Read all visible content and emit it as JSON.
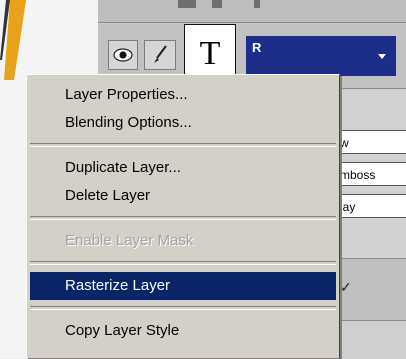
{
  "layers_panel": {
    "layer_thumbnail_glyph": "T",
    "layer_name": "R",
    "effects": [
      "w",
      "mboss",
      "lay"
    ],
    "check_glyph": "✓"
  },
  "context_menu": {
    "groups": [
      [
        {
          "label": "Layer Properties...",
          "state": "normal"
        },
        {
          "label": "Blending Options...",
          "state": "normal"
        }
      ],
      [
        {
          "label": "Duplicate Layer...",
          "state": "normal"
        },
        {
          "label": "Delete Layer",
          "state": "normal"
        }
      ],
      [
        {
          "label": "Enable Layer Mask",
          "state": "disabled"
        }
      ],
      [
        {
          "label": "Rasterize Layer",
          "state": "selected"
        }
      ],
      [
        {
          "label": "Copy Layer Style",
          "state": "normal"
        }
      ]
    ]
  },
  "colors": {
    "menu_background": "#d4d0c8",
    "selection_highlight": "#0a246a",
    "selected_layer": "#1c2d8a",
    "disabled_text": "#a2a2a2",
    "accent_stroke": "#e8a21c"
  },
  "icons": [
    "eye-icon",
    "brush-icon",
    "type-layer-icon",
    "dropdown-arrow-icon"
  ]
}
